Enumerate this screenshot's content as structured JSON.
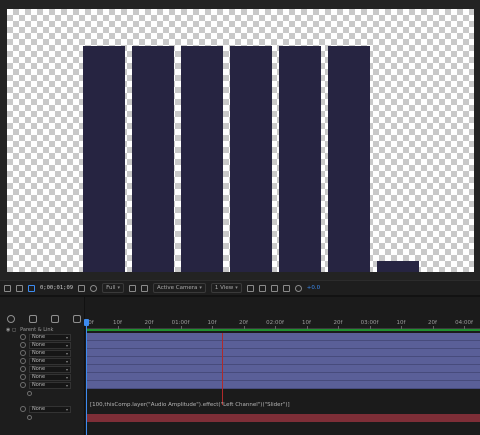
{
  "composition": {
    "bar_color": "#262441",
    "bars": [
      {
        "level": 0.86
      },
      {
        "level": 0.86
      },
      {
        "level": 0.86
      },
      {
        "level": 0.86
      },
      {
        "level": 0.86
      },
      {
        "level": 0.86
      },
      {
        "level": 0.04
      }
    ]
  },
  "viewer_toolbar": {
    "timecode": "0;00;01;09",
    "resolution": "Full",
    "camera": "Active Camera",
    "view": "1 View",
    "exposure": "+0.0"
  },
  "timeline": {
    "column_header": "Parent & Link",
    "ruler_ticks": [
      "0f",
      "10f",
      "20f",
      "01:00f",
      "10f",
      "20f",
      "02:00f",
      "10f",
      "20f",
      "03:00f",
      "10f",
      "20f",
      "04:00f"
    ],
    "layers": [
      {
        "parent": "None"
      },
      {
        "parent": "None"
      },
      {
        "parent": "None"
      },
      {
        "parent": "None"
      },
      {
        "parent": "None"
      },
      {
        "parent": "None"
      },
      {
        "parent": "None"
      }
    ],
    "expression": "[100,thisComp.layer(\"Audio Amplitude\").effect(\"Left Channel\")(\"Slider\")]",
    "audio_layer_parent": "None",
    "layer_bar_color": "#5a5f98",
    "audio_bar_color": "#7e2e37",
    "accent_color": "#3d8bf0"
  }
}
